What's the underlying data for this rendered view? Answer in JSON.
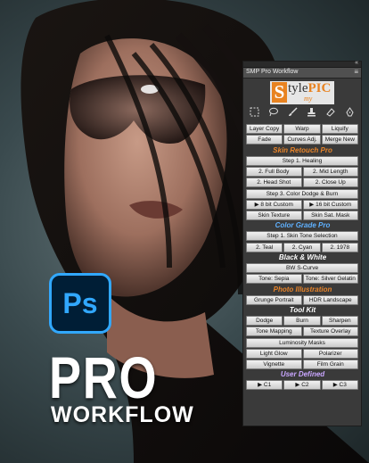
{
  "promo": {
    "app_logo_text": "Ps",
    "title_line1": "PRO",
    "title_line2": "WORKFLOW"
  },
  "panel": {
    "tab_label": "SMP Pro Workflow",
    "collapse_glyph": "«",
    "menu_glyph": "≡",
    "logo": {
      "s": "S",
      "tyle": "tyle",
      "pic": "PIC",
      "my": "my"
    },
    "tool_icons": [
      "rect-marquee-icon",
      "lasso-icon",
      "brush-icon",
      "stamp-icon",
      "eraser-icon",
      "pen-icon"
    ],
    "colors": {
      "header_orange": "#e8842a",
      "header_blue": "#5fb1ff",
      "header_white": "#ffffff",
      "header_purple": "#c9a6ff"
    },
    "rows": [
      {
        "buttons": [
          "Layer Copy",
          "Warp",
          "Liquify"
        ]
      },
      {
        "buttons": [
          "Fade",
          "Curves Adj.",
          "Merge New"
        ]
      },
      {
        "header": "Skin Retouch Pro"
      },
      {
        "buttons": [
          "Step 1. Healing"
        ]
      },
      {
        "buttons": [
          "2. Full Body",
          "2. Mid Length"
        ]
      },
      {
        "buttons": [
          "2. Head Shot",
          "2. Close Up"
        ]
      },
      {
        "buttons": [
          "Step 3. Color Dodge & Burn"
        ]
      },
      {
        "buttons": [
          "▶ 8 bit Custom",
          "▶ 16 bit Custom"
        ]
      },
      {
        "buttons": [
          "Skin Texture",
          "Skin Sat. Mask"
        ]
      },
      {
        "header": "Color Grade Pro"
      },
      {
        "buttons": [
          "Step 1. Skin Tone Selection"
        ]
      },
      {
        "buttons": [
          "2. Teal",
          "2. Cyan",
          "2. 1978"
        ]
      },
      {
        "header": "Black & White"
      },
      {
        "buttons": [
          "BW S-Curve"
        ]
      },
      {
        "buttons": [
          "Tone: Sepia",
          "Tone: Silver Gelatin"
        ]
      },
      {
        "header": "Photo Illustration"
      },
      {
        "buttons": [
          "Grunge Portrait",
          "HDR Landscape"
        ]
      },
      {
        "header": "Tool Kit"
      },
      {
        "buttons": [
          "Dodge",
          "Burn",
          "Sharpen"
        ]
      },
      {
        "buttons": [
          "Tone Mapping",
          "Texture Overlay"
        ]
      },
      {
        "buttons": [
          "Luminosity Masks"
        ]
      },
      {
        "buttons": [
          "Light Glow",
          "Polarizer"
        ]
      },
      {
        "buttons": [
          "Vignette",
          "Film Grain"
        ]
      },
      {
        "header": "User Defined"
      },
      {
        "buttons": [
          "▶ C1",
          "▶ C2",
          "▶ C3"
        ]
      }
    ]
  }
}
